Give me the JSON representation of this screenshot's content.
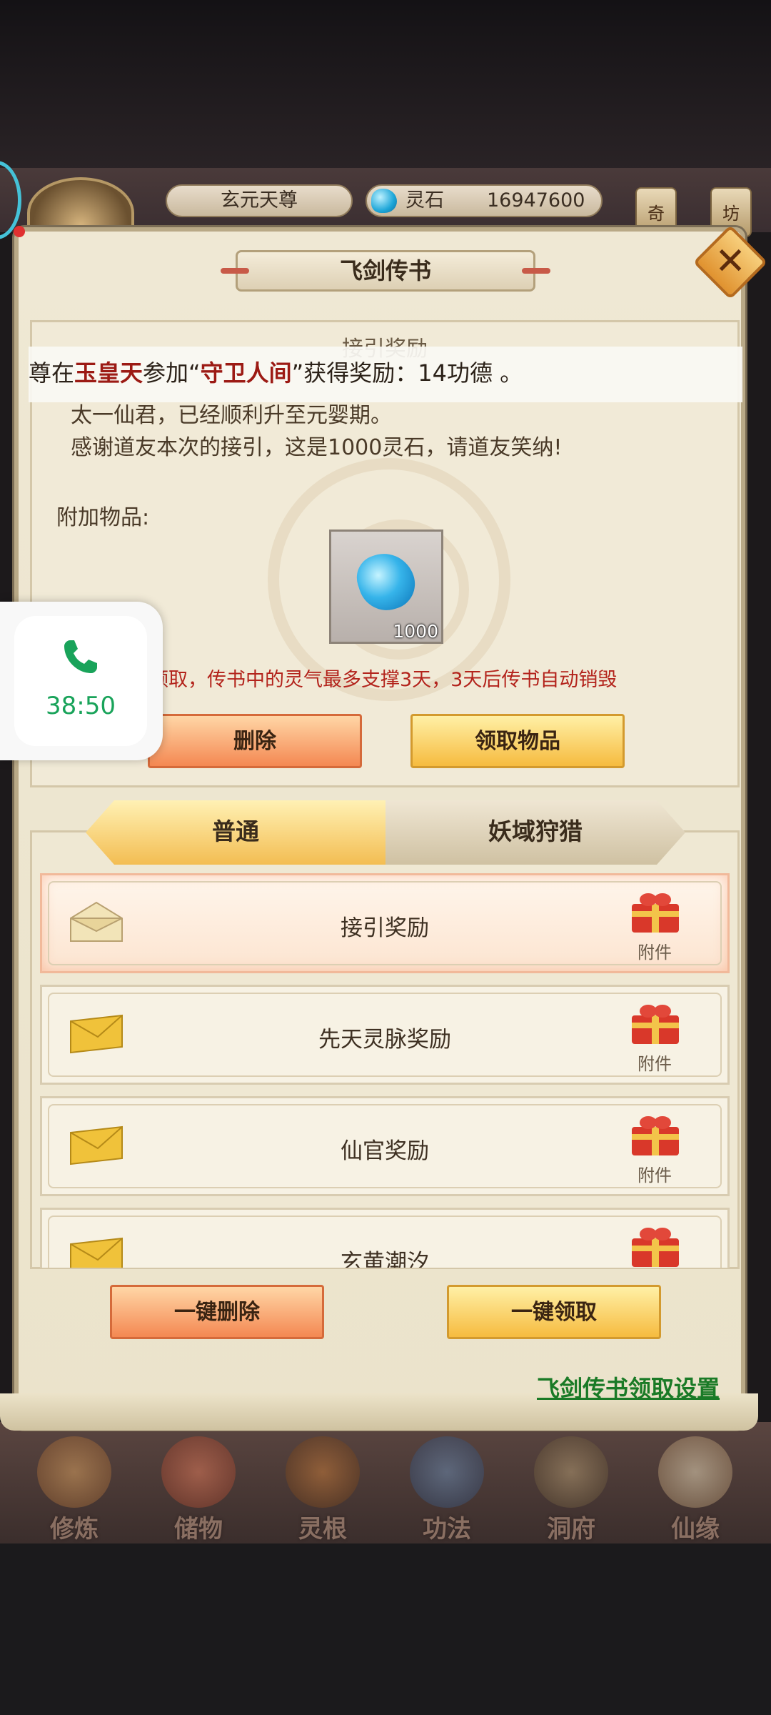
{
  "header": {
    "player_name": "玄元天尊",
    "currency_label": "灵石",
    "currency_value": "16947600",
    "side_tabs": [
      "奇",
      "坊"
    ]
  },
  "dialog": {
    "title": "飞剑传书",
    "close_symbol": "✕",
    "mail": {
      "subject": "接引奖励",
      "body_lines": [
        "太一仙君，已经顺利升至元婴期。",
        "感谢道友本次的接引，这是1000灵石，请道友笑纳!"
      ],
      "attachments_label": "附加物品:",
      "item_qty": "1000",
      "notice": "领取，传书中的灵气最多支撑3天，3天后传书自动销毁",
      "delete_label": "删除",
      "claim_label": "领取物品"
    },
    "marquee": {
      "part1": "尊在",
      "place": "玉皇天",
      "part2": "参加“",
      "event": "守卫人间",
      "part3": "”获得奖励：14功德 。"
    },
    "tabs": [
      "普通",
      "妖域狩猎"
    ],
    "mail_list": [
      {
        "title": "接引奖励",
        "attachment": "附件",
        "opened": true
      },
      {
        "title": "先天灵脉奖励",
        "attachment": "附件",
        "opened": false
      },
      {
        "title": "仙官奖励",
        "attachment": "附件",
        "opened": false
      },
      {
        "title": "玄黄潮汐",
        "attachment": "",
        "opened": false
      }
    ],
    "delete_all_label": "一键删除",
    "claim_all_label": "一键领取",
    "settings_link": "飞剑传书领取设置"
  },
  "call_widget": {
    "timer": "38:50",
    "icon": "phone-icon"
  },
  "bottom_nav": [
    "修炼",
    "储物",
    "灵根",
    "功法",
    "洞府",
    "仙缘"
  ],
  "colors": {
    "accent_red": "#b3231b",
    "link_green": "#1a7a26",
    "call_green": "#19a35a"
  }
}
